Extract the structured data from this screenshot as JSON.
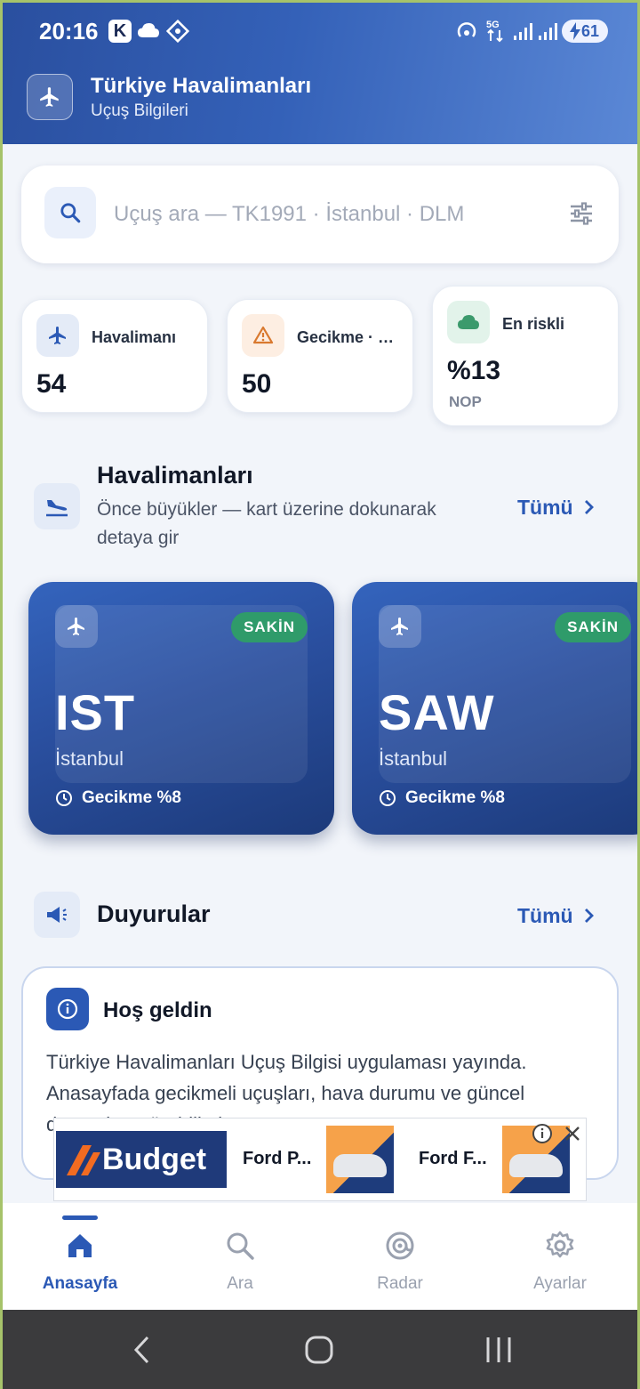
{
  "status_bar": {
    "time": "20:16",
    "k_badge": "K",
    "battery": "61"
  },
  "header": {
    "title": "Türkiye Havalimanları",
    "subtitle": "Uçuş Bilgileri"
  },
  "search": {
    "placeholder": "Uçuş ara — TK1991 · İstanbul · DLM"
  },
  "stats": [
    {
      "label": "Havalimanı",
      "value": "54",
      "sub": ""
    },
    {
      "label": "Gecikme · …",
      "value": "50",
      "sub": ""
    },
    {
      "label": "En riskli",
      "value": "%13",
      "sub": "NOP"
    }
  ],
  "airports_section": {
    "title": "Havalimanları",
    "description": "Önce büyükler — kart üzerine dokunarak detaya gir",
    "see_all": "Tümü"
  },
  "airports": [
    {
      "code": "IST",
      "city": "İstanbul",
      "badge": "SAKİN",
      "delay": "Gecikme %8"
    },
    {
      "code": "SAW",
      "city": "İstanbul",
      "badge": "SAKİN",
      "delay": "Gecikme %8"
    }
  ],
  "announcements_section": {
    "title": "Duyurular",
    "see_all": "Tümü"
  },
  "announcement": {
    "title": "Hoş geldin",
    "body": "Türkiye Havalimanları Uçuş Bilgisi uygulaması yayında. Anasayfada gecikmeli uçuşları, hava durumu ve güncel duyuruları görebilirsin."
  },
  "ad": {
    "brand": "Budget",
    "item1": "Ford P...",
    "item2": "Ford F..."
  },
  "bottom_nav": [
    {
      "label": "Anasayfa",
      "active": true
    },
    {
      "label": "Ara",
      "active": false
    },
    {
      "label": "Radar",
      "active": false
    },
    {
      "label": "Ayarlar",
      "active": false
    }
  ],
  "colors": {
    "primary": "#2b59b5",
    "header_start": "#2a4f9f",
    "header_end": "#5b88d6",
    "badge_green": "#2f9b6a",
    "warning_bg": "#fdeee2",
    "success_bg": "#e2f3ea"
  }
}
